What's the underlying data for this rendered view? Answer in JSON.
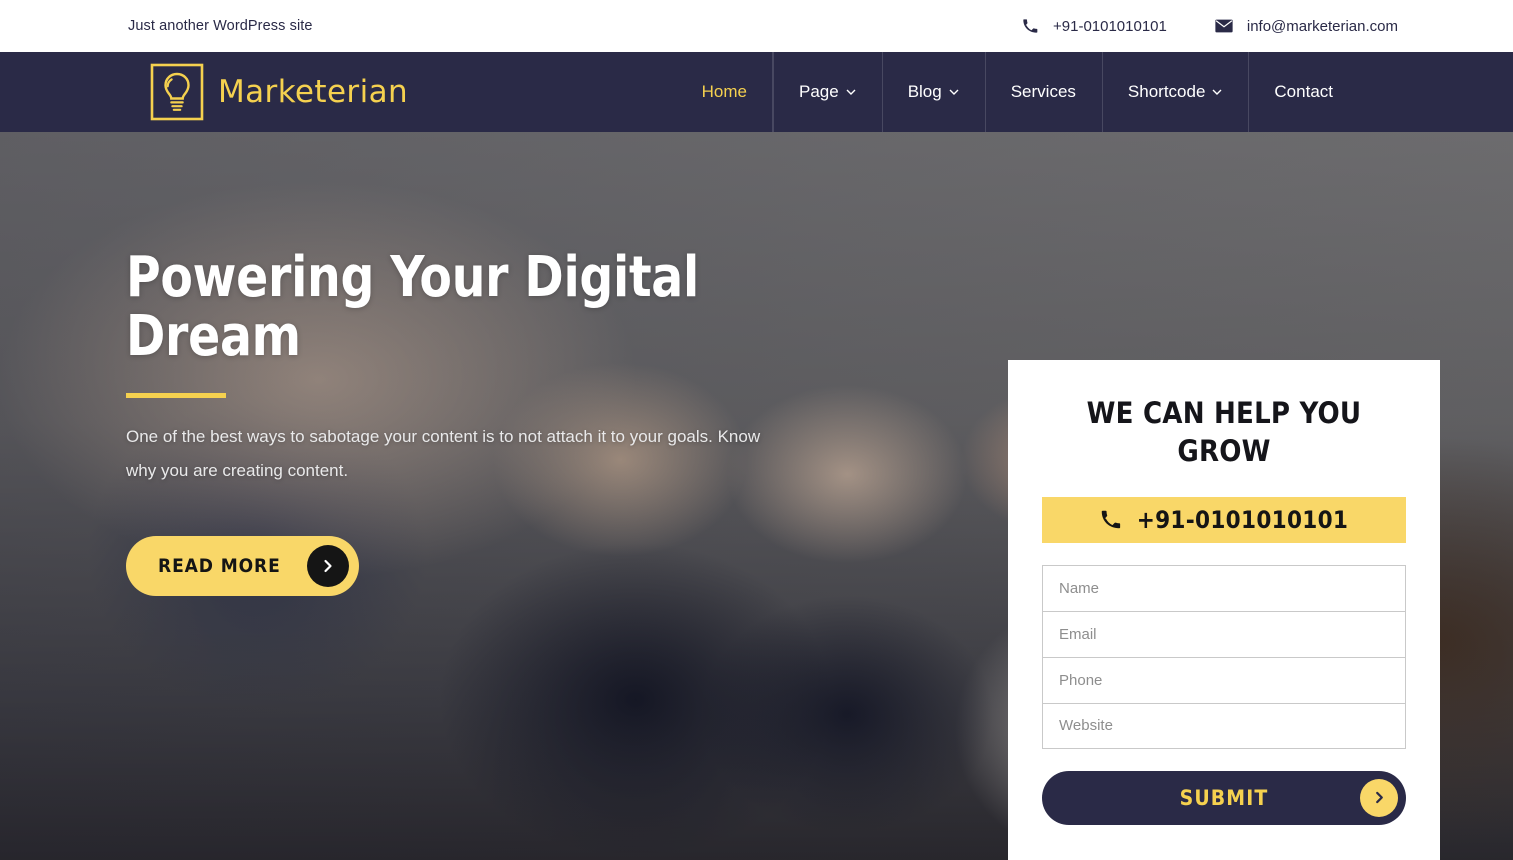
{
  "topbar": {
    "tagline": "Just another WordPress site",
    "phone": "+91-0101010101",
    "email": "info@marketerian.com",
    "phone_icon": "phone-icon",
    "email_icon": "envelope-icon"
  },
  "header": {
    "brand_name": "Marketerian",
    "brand_icon": "lightbulb-in-frame-icon",
    "nav": [
      {
        "label": "Home",
        "active": true,
        "has_dropdown": false
      },
      {
        "label": "Page",
        "active": false,
        "has_dropdown": true
      },
      {
        "label": "Blog",
        "active": false,
        "has_dropdown": true
      },
      {
        "label": "Services",
        "active": false,
        "has_dropdown": false
      },
      {
        "label": "Shortcode",
        "active": false,
        "has_dropdown": true
      },
      {
        "label": "Contact",
        "active": false,
        "has_dropdown": false
      }
    ]
  },
  "hero": {
    "title": "Powering Your Digital Dream",
    "subtitle": "One of the best ways to sabotage your content is to not attach it to your goals. Know why you are creating content.",
    "cta_label": "READ MORE",
    "cta_icon": "chevron-right-icon"
  },
  "form_card": {
    "title": "WE CAN HELP YOU GROW",
    "phone_button": "+91-0101010101",
    "phone_icon": "phone-icon",
    "fields": [
      {
        "name": "name",
        "placeholder": "Name",
        "value": ""
      },
      {
        "name": "email",
        "placeholder": "Email",
        "value": ""
      },
      {
        "name": "phone",
        "placeholder": "Phone",
        "value": ""
      },
      {
        "name": "website",
        "placeholder": "Website",
        "value": ""
      }
    ],
    "submit_label": "SUBMIT",
    "submit_icon": "chevron-right-icon"
  },
  "colors": {
    "navy": "#2a2a47",
    "yellow": "#f5d14f",
    "yellow_button": "#f9d768",
    "white": "#ffffff",
    "dark_text": "#151515"
  }
}
